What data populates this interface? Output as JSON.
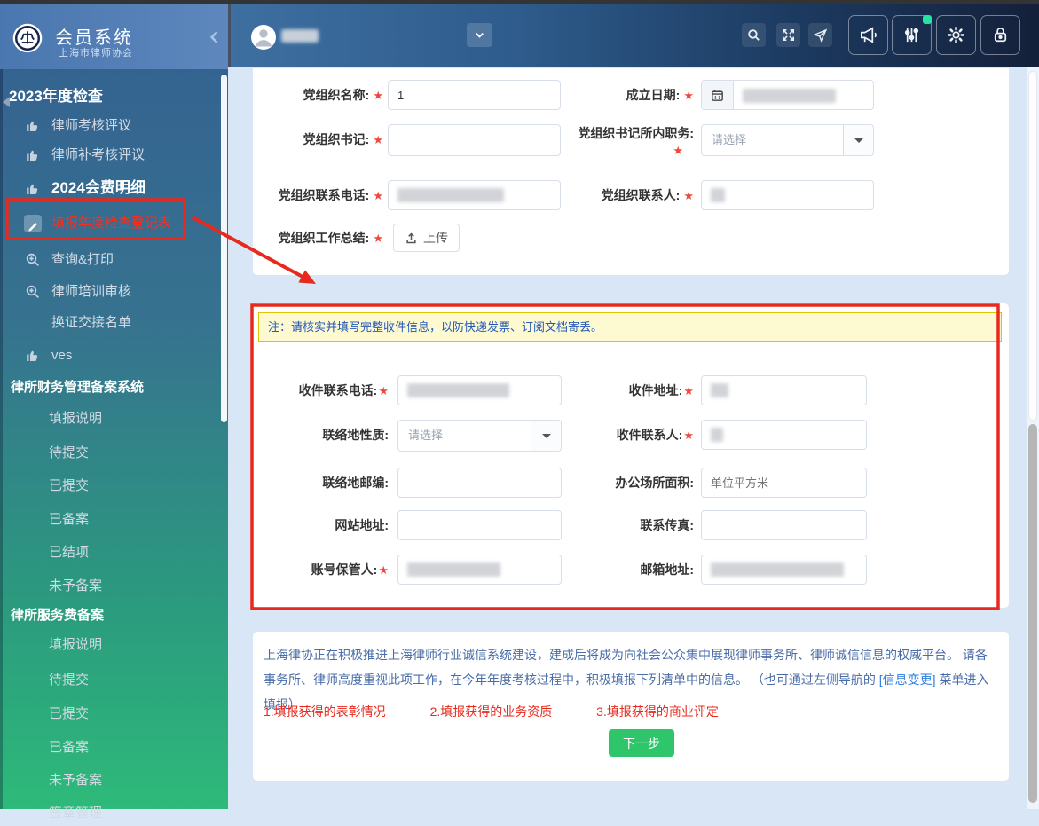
{
  "app": {
    "title": "会员系统",
    "subtitle": "上海市律师协会",
    "required_marker": "★",
    "colors": {
      "annotation_red": "#e8291d",
      "next_button_green": "#2fc66b",
      "note_bg": "#fdfad2",
      "note_border": "#e6c200",
      "note_text": "#2558b8",
      "sidebar_top": "#345f91",
      "sidebar_bottom": "#2eba7a",
      "highlight_item_red": "#fe2c1c"
    }
  },
  "header": {
    "icons": [
      "chevron-down",
      "search",
      "fullscreen",
      "send",
      "megaphone",
      "sliders",
      "gear",
      "lock"
    ],
    "sliders_has_badge": true
  },
  "sidebar": {
    "groups": [
      {
        "header": "2023年度检查",
        "items": [
          {
            "label": "律师考核评议",
            "icon": "thumbs-up"
          },
          {
            "label": "律师补考核评议",
            "icon": "thumbs-up"
          },
          {
            "label": "2024会费明细",
            "icon": "thumbs-up"
          },
          {
            "label": "填报年度检查登记表",
            "icon": "pencil"
          },
          {
            "label": "查询&打印",
            "icon": "zoom-plus"
          },
          {
            "label": "律师培训审核",
            "icon": "zoom-plus"
          },
          {
            "label": "换证交接名单",
            "icon": ""
          },
          {
            "label": "ves",
            "icon": "thumbs-up"
          }
        ]
      },
      {
        "header": "律所财务管理备案系统",
        "items": [
          {
            "label": "填报说明"
          },
          {
            "label": "待提交"
          },
          {
            "label": "已提交"
          },
          {
            "label": "已备案"
          },
          {
            "label": "已结项"
          },
          {
            "label": "未予备案"
          }
        ]
      },
      {
        "header": "律所服务费备案",
        "items": [
          {
            "label": "填报说明"
          },
          {
            "label": "待提交"
          },
          {
            "label": "已提交"
          },
          {
            "label": "已备案"
          },
          {
            "label": "未予备案"
          },
          {
            "label": "签章管理"
          }
        ]
      }
    ]
  },
  "party_form": {
    "fields": {
      "name": {
        "label": "党组织名称:",
        "value": "1",
        "required": true
      },
      "found_date": {
        "label": "成立日期:",
        "required": true,
        "redacted": true
      },
      "secretary": {
        "label": "党组织书记:",
        "value": "",
        "required": true
      },
      "secretary_post": {
        "label": "党组织书记所内职务:",
        "placeholder": "请选择",
        "required": true
      },
      "phone": {
        "label": "党组织联系电话:",
        "required": true,
        "redacted": true
      },
      "contact": {
        "label": "党组织联系人:",
        "required": true,
        "redacted": true
      },
      "summary": {
        "label": "党组织工作总结:",
        "required": true,
        "upload_label": "上传"
      }
    }
  },
  "recipient_form": {
    "note": "注：请核实并填写完整收件信息，以防快递发票、订阅文档寄丢。",
    "fields": {
      "recv_phone": {
        "label": "收件联系电话:",
        "required": true,
        "redacted": true
      },
      "recv_address": {
        "label": "收件地址:",
        "required": true,
        "redacted": true
      },
      "place_type": {
        "label": "联络地性质:",
        "placeholder": "请选择"
      },
      "recv_contact": {
        "label": "收件联系人:",
        "required": true,
        "redacted": true
      },
      "zip": {
        "label": "联络地邮编:",
        "value": ""
      },
      "office_area": {
        "label": "办公场所面积:",
        "placeholder": "单位平方米"
      },
      "website": {
        "label": "网站地址:",
        "value": ""
      },
      "fax": {
        "label": "联系传真:",
        "value": ""
      },
      "account_keeper": {
        "label": "账号保管人:",
        "required": true,
        "redacted": true
      },
      "email": {
        "label": "邮箱地址:",
        "redacted": true
      }
    }
  },
  "footer": {
    "notice_before": "上海律协正在积极推进上海律师行业诚信系统建设，建成后将成为向社会公众集中展现律师事务所、律师诚信信息的权威平台。 请各事务所、律师高度重视此项工作，在今年年度考核过程中，积极填报下列清单中的信息。 （也可通过左侧导航的 ",
    "notice_link": "[信息变更]",
    "notice_after": " 菜单进入填报）",
    "links": [
      "1.填报获得的表彰情况",
      "2.填报获得的业务资质",
      "3.填报获得的商业评定"
    ],
    "next_button": "下一步"
  }
}
